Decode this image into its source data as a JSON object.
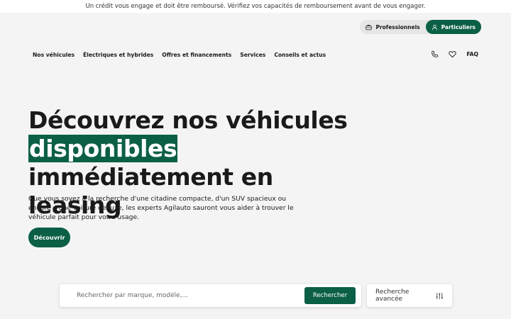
{
  "disclaimer": "Un crédit vous engage et doit être remboursé. Vérifiez vos capacités de remboursement avant de vous engager.",
  "switch": {
    "pro": "Professionnels",
    "part": "Particuliers"
  },
  "nav": {
    "items": [
      "Nos véhicules",
      "Électriques et hybrides",
      "Offres et financements",
      "Services",
      "Conseils et actus"
    ],
    "faq": "FAQ"
  },
  "hero": {
    "title_1": " Découvrez nos véhicules",
    "title_hl": "disponibles",
    "title_2": " immédiatement en leasing",
    "text": "Que vous soyez à la recherche d'une citadine compacte, d'un SUV spacieux ou encore d'une voiture de luxe, les experts Agilauto sauront vous aider à trouver le véhicule parfait pour votre usage.",
    "cta": "Découvrir"
  },
  "search": {
    "placeholder": "Rechercher par marque, modèle,...",
    "button": "Rechercher",
    "advanced": "Recherche avancée"
  },
  "colors": {
    "brand": "#0b5f46",
    "background": "#f4f4f4"
  }
}
